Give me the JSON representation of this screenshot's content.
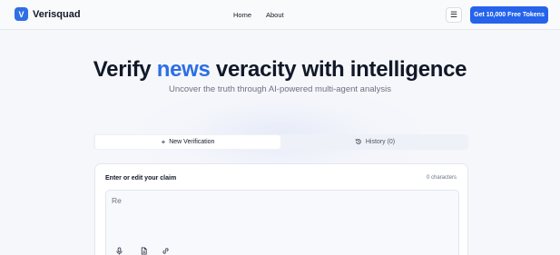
{
  "header": {
    "logo_letter": "V",
    "brand": "Verisquad",
    "nav": [
      "Home",
      "About"
    ],
    "cta_label": "Get 10,000 Free Tokens",
    "menu_icon": "hamburger-icon"
  },
  "hero": {
    "title_start": "Verify ",
    "title_accent": "news",
    "title_end": " veracity with intelligence",
    "subtitle": "Uncover the truth through AI-powered multi-agent analysis"
  },
  "tabs": [
    {
      "label": "New Verification",
      "icon": "plus-icon",
      "active": true
    },
    {
      "label": "History (0)",
      "icon": "history-icon",
      "active": false
    }
  ],
  "claim": {
    "label": "Enter or edit your claim",
    "char_count": "0 characters",
    "value": "Re",
    "tools": [
      "microphone-icon",
      "file-icon",
      "link-icon"
    ]
  },
  "colors": {
    "accent": "#2563eb",
    "brand": "#2f6fe4"
  }
}
